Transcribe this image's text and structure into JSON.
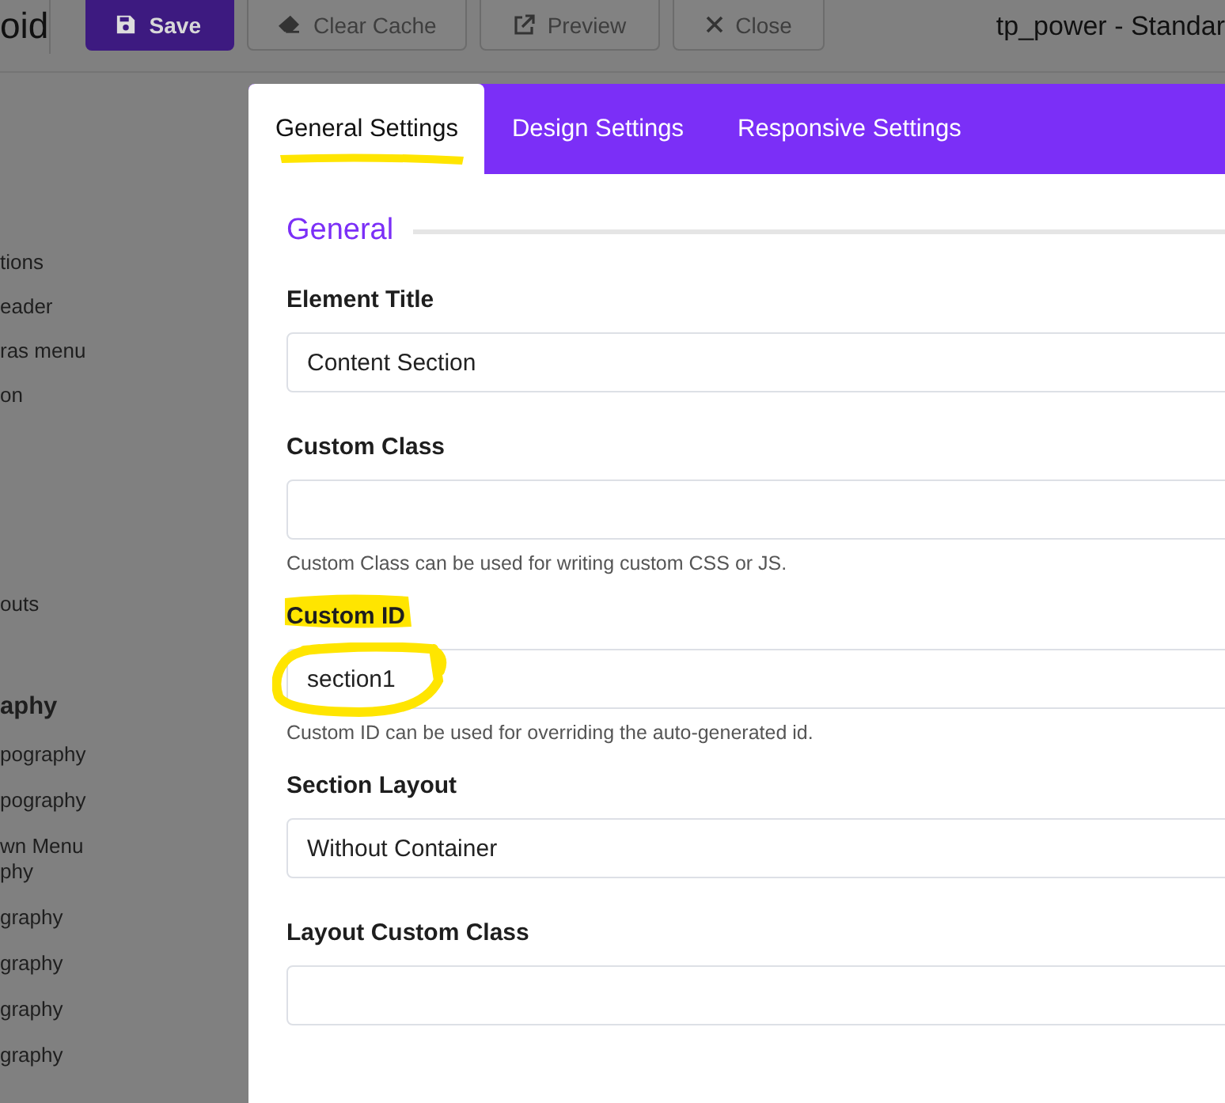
{
  "topbar": {
    "brand": "oid",
    "buttons": [
      {
        "label": "Save",
        "kind": "primary"
      },
      {
        "label": "Clear Cache",
        "kind": "default"
      },
      {
        "label": "Preview",
        "kind": "default"
      },
      {
        "label": "Close",
        "kind": "default"
      }
    ],
    "title": "tp_power - Standar"
  },
  "sidebar": {
    "groups": [
      {
        "items": [
          "tions",
          "eader",
          "ras menu",
          "on"
        ]
      },
      {
        "items": [
          "outs"
        ]
      },
      {
        "heading": "aphy",
        "items": [
          "pography",
          "pography",
          "wn Menu\nphy",
          "graphy",
          "graphy",
          "graphy",
          "graphy"
        ]
      }
    ]
  },
  "dialog": {
    "tabs": [
      {
        "label": "General Settings",
        "selected": true,
        "highlighted": true
      },
      {
        "label": "Design Settings",
        "selected": false,
        "highlighted": false
      },
      {
        "label": "Responsive Settings",
        "selected": false,
        "highlighted": false
      }
    ],
    "section_title": "General",
    "fields": [
      {
        "label": "Element Title",
        "value": "Content Section",
        "label_highlighted": false,
        "value_circled": false
      },
      {
        "label": "Custom Class",
        "help": "Custom Class can be used for writing custom CSS or JS.",
        "label_highlighted": false,
        "value_circled": false
      },
      {
        "label": "Custom ID",
        "value": "section1",
        "help": "Custom ID can be used for overriding the auto-generated id.",
        "label_highlighted": true,
        "value_circled": true
      },
      {
        "label": "Section Layout",
        "value": "Without Container",
        "label_highlighted": false,
        "value_circled": false
      },
      {
        "label": "Layout Custom Class",
        "label_highlighted": false,
        "value_circled": false
      }
    ]
  }
}
